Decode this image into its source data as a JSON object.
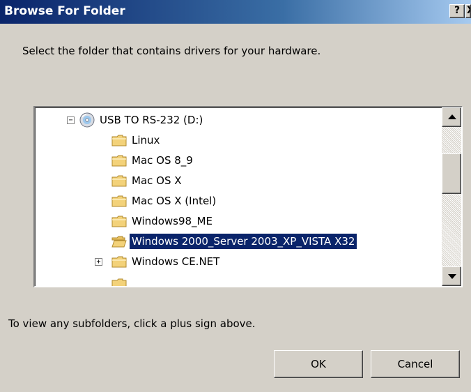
{
  "window": {
    "title": "Browse For Folder",
    "help_label": "?",
    "close_label": "X"
  },
  "prompt": "Select the folder that contains drivers for your hardware.",
  "tree": {
    "root": {
      "label": "USB TO RS-232 (D:)",
      "expander": "−",
      "icon": "cd-drive-icon"
    },
    "items": [
      {
        "label": "Linux"
      },
      {
        "label": "Mac OS 8_9"
      },
      {
        "label": "Mac OS X"
      },
      {
        "label": "Mac OS X (Intel)"
      },
      {
        "label": "Windows98_ME"
      },
      {
        "label": "Windows 2000_Server 2003_XP_VISTA X32",
        "selected": true
      },
      {
        "label": "Windows CE.NET",
        "expander": "+"
      }
    ]
  },
  "hint": "To view any subfolders, click a plus sign above.",
  "buttons": {
    "ok_label": "OK",
    "cancel_label": "Cancel"
  },
  "colors": {
    "titlebar": "#0a246a",
    "selection": "#0a246a",
    "folder": "#f3d27a"
  }
}
